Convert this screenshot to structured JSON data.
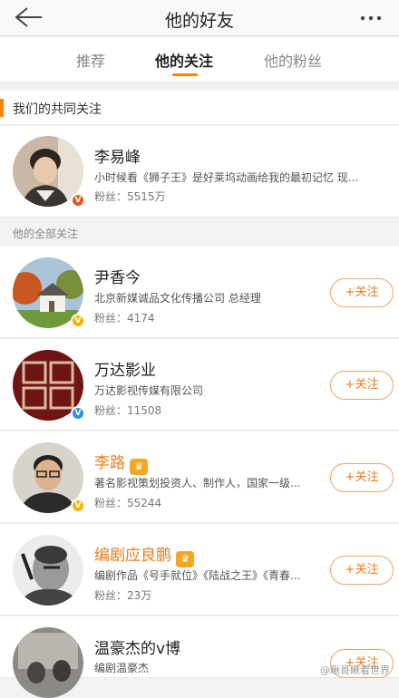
{
  "header": {
    "title": "他的好友"
  },
  "tabs": [
    {
      "label": "推荐"
    },
    {
      "label": "他的关注"
    },
    {
      "label": "他的粉丝"
    }
  ],
  "sections": {
    "mutual": "我们的共同关注",
    "all": "他的全部关注"
  },
  "mutual_user": {
    "name": "李易峰",
    "desc": "小时候看《狮子王》是好莱坞动画给我的最初记忆 现...",
    "fans": "粉丝：5515万"
  },
  "follow_button_label": "+关注",
  "users": [
    {
      "name": "尹香今",
      "desc": "北京新媒诚品文化传播公司 总经理",
      "fans": "粉丝：4174"
    },
    {
      "name": "万达影业",
      "desc": "万达影视传媒有限公司",
      "fans": "粉丝：11508"
    },
    {
      "name": "李路",
      "desc": "著名影视策划投资人、制作人，国家一级...",
      "fans": "粉丝：55244"
    },
    {
      "name": "编剧应良鹏",
      "desc": "编剧作品《号手就位》《陆战之王》《青春...",
      "fans": "粉丝：23万"
    },
    {
      "name": "温豪杰的v博",
      "desc": "编剧温豪杰",
      "fans": ""
    }
  ],
  "watermark": "@瞅哥瞅看世界",
  "colors": {
    "accent": "#ff8200",
    "vip": "#f6a623",
    "verified_gold": "#f7b500",
    "verified_blue": "#2e8ae8"
  }
}
